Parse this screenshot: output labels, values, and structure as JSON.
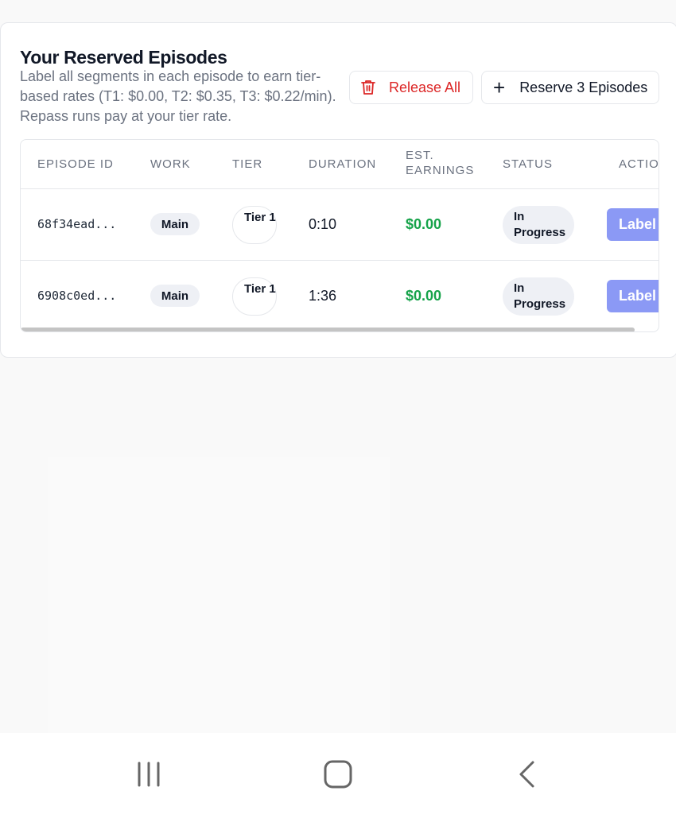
{
  "card": {
    "title": "Your Reserved Episodes",
    "description": "Label all segments in each episode to earn tier-based rates (T1: $0.00, T2: $0.35, T3: $0.22/min).  Repass runs pay at your tier rate."
  },
  "buttons": {
    "release_all": "Release All",
    "reserve": "Reserve 3 Episodes"
  },
  "table": {
    "headers": {
      "episode_id": "EPISODE ID",
      "work": "WORK",
      "tier": "TIER",
      "duration": "DURATION",
      "earnings": "EST. EARNINGS",
      "status": "STATUS",
      "actions": "ACTIONS"
    },
    "rows": [
      {
        "episode_id": "68f34ead...",
        "work": "Main",
        "tier": "Tier 1",
        "duration": "0:10",
        "earnings": "$0.00",
        "status": "In Progress",
        "action": "Label"
      },
      {
        "episode_id": "6908c0ed...",
        "work": "Main",
        "tier": "Tier 1",
        "duration": "1:36",
        "earnings": "$0.00",
        "status": "In Progress",
        "action": "Label"
      }
    ]
  },
  "colors": {
    "danger": "#dc2626",
    "success": "#16a34a",
    "label_button": "#8b99f5"
  },
  "icons": {
    "release": "trash-icon",
    "reserve": "plus-icon",
    "nav_recent": "recent-apps-icon",
    "nav_home": "home-icon",
    "nav_back": "back-icon"
  }
}
